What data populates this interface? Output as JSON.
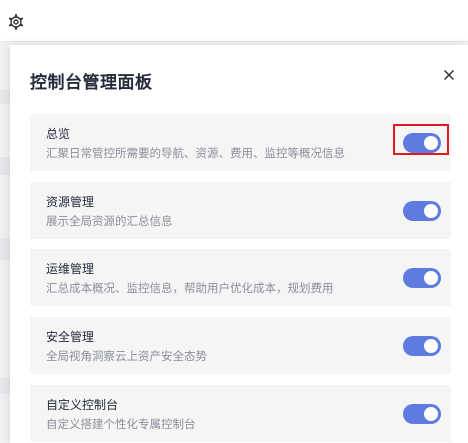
{
  "topbar": {
    "settings_icon": "gear-icon"
  },
  "panel": {
    "title": "控制台管理面板",
    "close_icon": "close-icon",
    "cards": [
      {
        "title": "总览",
        "description": "汇聚日常管控所需要的导航、资源、费用、监控等概况信息",
        "enabled": true
      },
      {
        "title": "资源管理",
        "description": "展示全局资源的汇总信息",
        "enabled": true
      },
      {
        "title": "运维管理",
        "description": "汇总成本概况、监控信息，帮助用户优化成本，规划费用",
        "enabled": true
      },
      {
        "title": "安全管理",
        "description": "全局视角洞察云上资产安全态势",
        "enabled": true
      },
      {
        "title": "自定义控制台",
        "description": "自定义搭建个性化专属控制台",
        "enabled": true
      }
    ]
  },
  "colors": {
    "toggle_on": "#5e7ce0",
    "highlight_box": "#e0191e",
    "card_bg": "#f5f5f6"
  }
}
